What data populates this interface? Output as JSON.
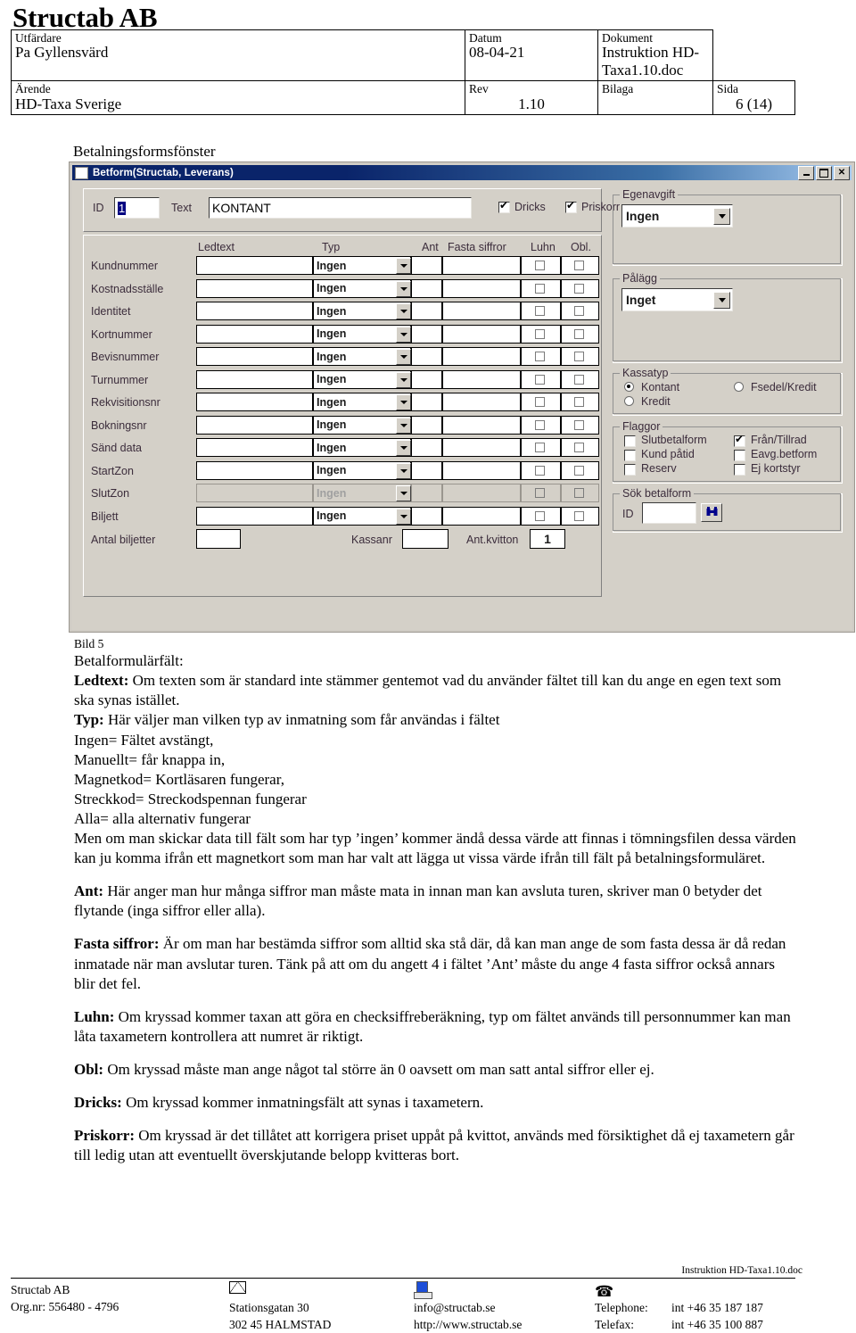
{
  "header": {
    "brand": "Structab AB",
    "row1": {
      "label1": "Utfärdare",
      "value1": "Pa Gyllensvärd",
      "label2": "Datum",
      "value2": "08-04-21",
      "label3": "Dokument",
      "value3": "Instruktion HD-Taxa1.10.doc"
    },
    "row2": {
      "label1": "Ärende",
      "value1": "HD-Taxa Sverige",
      "label2": "Rev",
      "value2": "1.10",
      "label3": "Bilaga",
      "value3": "",
      "label4": "Sida",
      "value4": "6 (14)"
    }
  },
  "caption": "Betalningsformsfönster",
  "dialog": {
    "title": "Betform(Structab, Leverans)",
    "buttons": {
      "minimize": "_",
      "maximize": "□",
      "close": "✕"
    },
    "top": {
      "id_label": "ID",
      "id_value": "1",
      "text_label": "Text",
      "text_value": "KONTANT",
      "dricks_label": "Dricks",
      "dricks_checked": true,
      "priskorr_label": "Priskorr",
      "priskorr_checked": true
    },
    "grid": {
      "headers": [
        "Ledtext",
        "Typ",
        "Ant",
        "Fasta siffror",
        "Luhn",
        "Obl."
      ],
      "rows": [
        {
          "label": "Kundnummer",
          "ledtext": "",
          "typ": "Ingen",
          "ant": "",
          "fasta": "",
          "luhn": false,
          "obl": false,
          "disabled": false
        },
        {
          "label": "Kostnadsställe",
          "ledtext": "",
          "typ": "Ingen",
          "ant": "",
          "fasta": "",
          "luhn": false,
          "obl": false,
          "disabled": false
        },
        {
          "label": "Identitet",
          "ledtext": "",
          "typ": "Ingen",
          "ant": "",
          "fasta": "",
          "luhn": false,
          "obl": false,
          "disabled": false
        },
        {
          "label": "Kortnummer",
          "ledtext": "",
          "typ": "Ingen",
          "ant": "",
          "fasta": "",
          "luhn": false,
          "obl": false,
          "disabled": false
        },
        {
          "label": "Bevisnummer",
          "ledtext": "",
          "typ": "Ingen",
          "ant": "",
          "fasta": "",
          "luhn": false,
          "obl": false,
          "disabled": false
        },
        {
          "label": "Turnummer",
          "ledtext": "",
          "typ": "Ingen",
          "ant": "",
          "fasta": "",
          "luhn": false,
          "obl": false,
          "disabled": false
        },
        {
          "label": "Rekvisitionsnr",
          "ledtext": "",
          "typ": "Ingen",
          "ant": "",
          "fasta": "",
          "luhn": false,
          "obl": false,
          "disabled": false
        },
        {
          "label": "Bokningsnr",
          "ledtext": "",
          "typ": "Ingen",
          "ant": "",
          "fasta": "",
          "luhn": false,
          "obl": false,
          "disabled": false
        },
        {
          "label": "Sänd data",
          "ledtext": "",
          "typ": "Ingen",
          "ant": "",
          "fasta": "",
          "luhn": false,
          "obl": false,
          "disabled": false
        },
        {
          "label": "StartZon",
          "ledtext": "",
          "typ": "Ingen",
          "ant": "",
          "fasta": "",
          "luhn": false,
          "obl": false,
          "disabled": false
        },
        {
          "label": "SlutZon",
          "ledtext": "",
          "typ": "Ingen",
          "ant": "",
          "fasta": "",
          "luhn": false,
          "obl": false,
          "disabled": true
        },
        {
          "label": "Biljett",
          "ledtext": "",
          "typ": "Ingen",
          "ant": "",
          "fasta": "",
          "luhn": false,
          "obl": false,
          "disabled": false
        }
      ],
      "footer": {
        "antal_label": "Antal biljetter",
        "antal_value": "",
        "kassanr_label": "Kassanr",
        "kassanr_value": "",
        "antkvitton_label": "Ant.kvitton",
        "antkvitton_value": "1"
      }
    },
    "egenavgift": {
      "title": "Egenavgift",
      "value": "Ingen"
    },
    "palagg": {
      "title": "Pålägg",
      "value": "Inget"
    },
    "kassatyp": {
      "title": "Kassatyp",
      "options": [
        {
          "label": "Kontant",
          "selected": true
        },
        {
          "label": "Fsedel/Kredit",
          "selected": false
        },
        {
          "label": "Kredit",
          "selected": false
        }
      ]
    },
    "flaggor": {
      "title": "Flaggor",
      "options": [
        {
          "label": "Slutbetalform",
          "checked": false
        },
        {
          "label": "Från/Tillrad",
          "checked": true
        },
        {
          "label": "Kund påtid",
          "checked": false
        },
        {
          "label": "Eavg.betform",
          "checked": false
        },
        {
          "label": "Reserv",
          "checked": false
        },
        {
          "label": "Ej kortstyr",
          "checked": false
        }
      ]
    },
    "sok": {
      "title": "Sök betalform",
      "id_label": "ID",
      "id_value": "",
      "find_icon": "binoculars-icon"
    }
  },
  "body": {
    "bild": "Bild 5",
    "section_title": "Betalformulärfält:",
    "ledtext_bold": "Ledtext:",
    "ledtext_text": " Om texten som är standard inte stämmer gentemot vad du använder fältet till kan du ange en egen text som ska synas istället.",
    "typ_bold": "Typ:",
    "typ_text": " Här väljer man vilken typ av inmatning som får användas i fältet",
    "typ_items": [
      "Ingen= Fältet avstängt,",
      "Manuellt= får knappa in,",
      "Magnetkod= Kortläsaren fungerar,",
      "Streckkod= Streckodspennan fungerar",
      "Alla= alla alternativ fungerar"
    ],
    "typ_after": "Men om man skickar data till fält som har typ ’ingen’ kommer ändå dessa värde att finnas i tömningsfilen dessa värden kan ju komma ifrån ett magnetkort som man har valt att lägga ut vissa värde ifrån till fält på betalningsformuläret.",
    "ant_bold": "Ant:",
    "ant_text": " Här anger man hur många siffror man måste mata in innan man kan avsluta turen, skriver man 0 betyder det flytande (inga siffror eller alla).",
    "fasta_bold": "Fasta siffror:",
    "fasta_text": " Är om man har bestämda siffror som alltid ska stå där, då kan man ange de som fasta dessa är då redan inmatade när man avslutar turen. Tänk på att om du angett 4 i fältet ’Ant’ måste du ange 4 fasta siffror också annars blir det fel.",
    "luhn_bold": "Luhn:",
    "luhn_text": " Om kryssad kommer taxan att göra en checksiffreberäkning, typ om fältet används till personnummer kan man låta taxametern kontrollera att numret är riktigt.",
    "obl_bold": "Obl:",
    "obl_text": " Om kryssad måste man ange något tal större än 0 oavsett om man satt antal siffror eller ej.",
    "dricks_bold": "Dricks:",
    "dricks_text": " Om kryssad kommer inmatningsfält att synas i taxametern.",
    "priskorr_bold": "Priskorr:",
    "priskorr_text": " Om kryssad är det tillåtet att korrigera priset uppåt på kvittot, används med försiktighet då ej taxametern går till ledig utan att eventuellt överskjutande belopp kvitteras bort."
  },
  "footer": {
    "doc": "Instruktion HD-Taxa1.10.doc",
    "company": "Structab AB",
    "orgnr": "Org.nr: 556480 - 4796",
    "address1": "Stationsgatan 30",
    "address2": "302 45 HALMSTAD",
    "email": "info@structab.se",
    "web": "http://www.structab.se",
    "telephone_label": "Telephone:",
    "telephone": "int +46 35 187 187",
    "telefax_label": "Telefax:",
    "telefax": "int +46 35 100 887"
  }
}
